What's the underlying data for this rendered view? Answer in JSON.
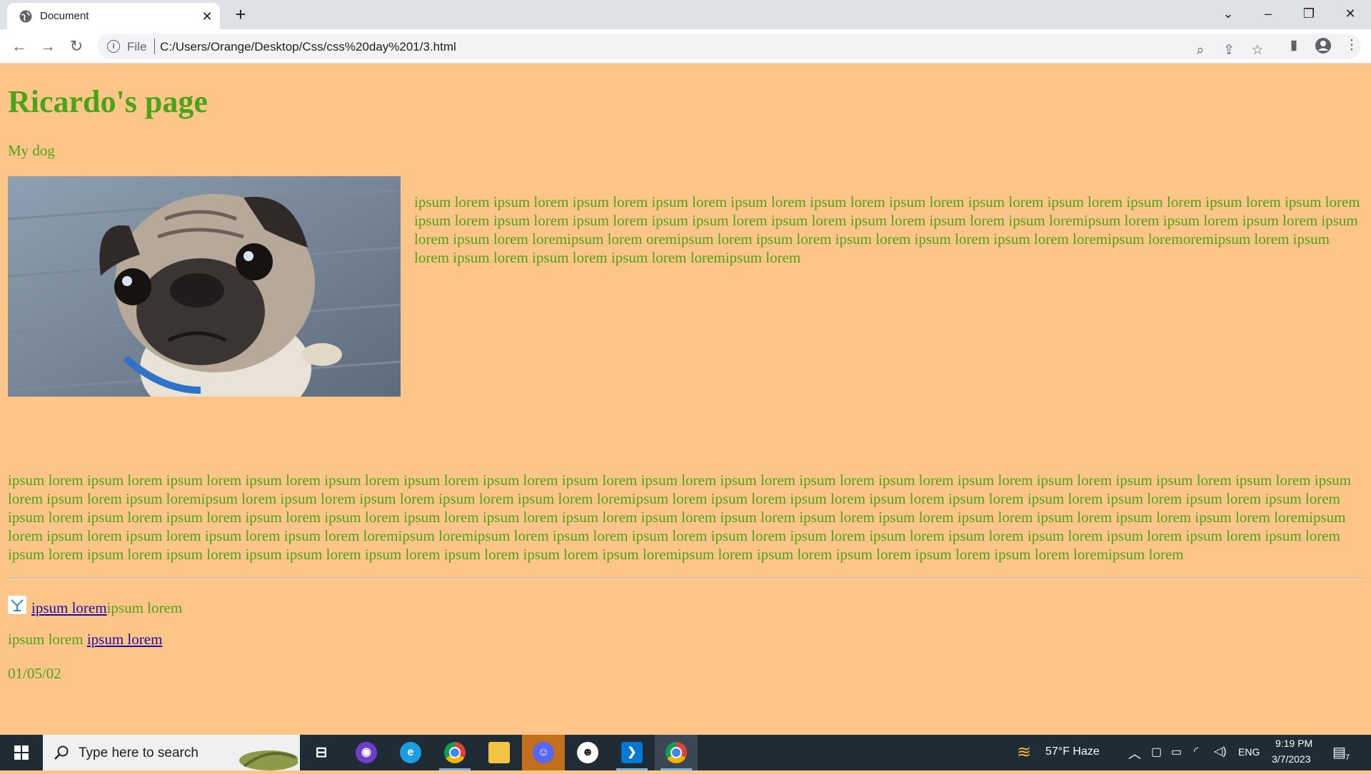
{
  "browser": {
    "tab_title": "Document",
    "address_scheme": "File",
    "address_url": "C:/Users/Orange/Desktop/Css/css%20day%201/3.html"
  },
  "page": {
    "title": "Ricardo's page",
    "subtitle": "My dog",
    "dog_image_alt": "pug photo",
    "paragraph1": "ipsum lorem ipsum lorem ipsum lorem ipsum lorem ipsum lorem ipsum lorem ipsum lorem ipsum lorem ipsum lorem ipsum lorem ipsum lorem ipsum lorem ipsum lorem ipsum lorem ipsum lorem ipsum ipsum lorem ipsum lorem ipsum lorem ipsum lorem ipsum loremipsum lorem ipsum lorem ipsum lorem ipsum lorem ipsum lorem loremipsum lorem oremipsum lorem ipsum lorem ipsum lorem ipsum lorem ipsum lorem loremipsum loremoremipsum lorem ipsum lorem ipsum lorem ipsum lorem ipsum lorem loremipsum lorem",
    "paragraph2": "ipsum lorem ipsum lorem ipsum lorem ipsum lorem ipsum lorem ipsum lorem ipsum lorem ipsum lorem ipsum lorem ipsum lorem ipsum lorem ipsum lorem ipsum lorem ipsum lorem ipsum ipsum lorem ipsum lorem ipsum lorem ipsum lorem ipsum loremipsum lorem ipsum lorem ipsum lorem ipsum lorem ipsum lorem loremipsum lorem ipsum lorem ipsum lorem ipsum lorem ipsum lorem ipsum lorem ipsum lorem ipsum lorem ipsum lorem ipsum lorem ipsum lorem ipsum lorem ipsum lorem ipsum lorem ipsum lorem ipsum lorem ipsum lorem ipsum lorem ipsum lorem ipsum lorem ipsum lorem ipsum lorem ipsum lorem ipsum lorem ipsum lorem loremipsum lorem ipsum lorem ipsum lorem ipsum lorem ipsum lorem loremipsum loremipsum lorem ipsum lorem ipsum lorem ipsum lorem ipsum lorem ipsum lorem ipsum lorem ipsum lorem ipsum lorem ipsum lorem ipsum lorem ipsum lorem ipsum lorem ipsum lorem ipsum ipsum lorem ipsum lorem ipsum lorem ipsum lorem ipsum loremipsum lorem ipsum lorem ipsum lorem ipsum lorem ipsum lorem loremipsum lorem",
    "line1_link": "ipsum lorem",
    "line1_text": "ipsum lorem",
    "line2_text": "ipsum lorem ",
    "line2_link": "ipsum lorem",
    "date": "01/05/02"
  },
  "colors": {
    "page_background": "#fec589",
    "text_green": "#4ba319",
    "link_blue": "#1a0dab"
  },
  "taskbar": {
    "search_placeholder": "Type here to search",
    "weather": "57°F  Haze",
    "language": "ENG",
    "time": "9:19 PM",
    "date": "3/7/2023",
    "notifications_count": "7"
  }
}
